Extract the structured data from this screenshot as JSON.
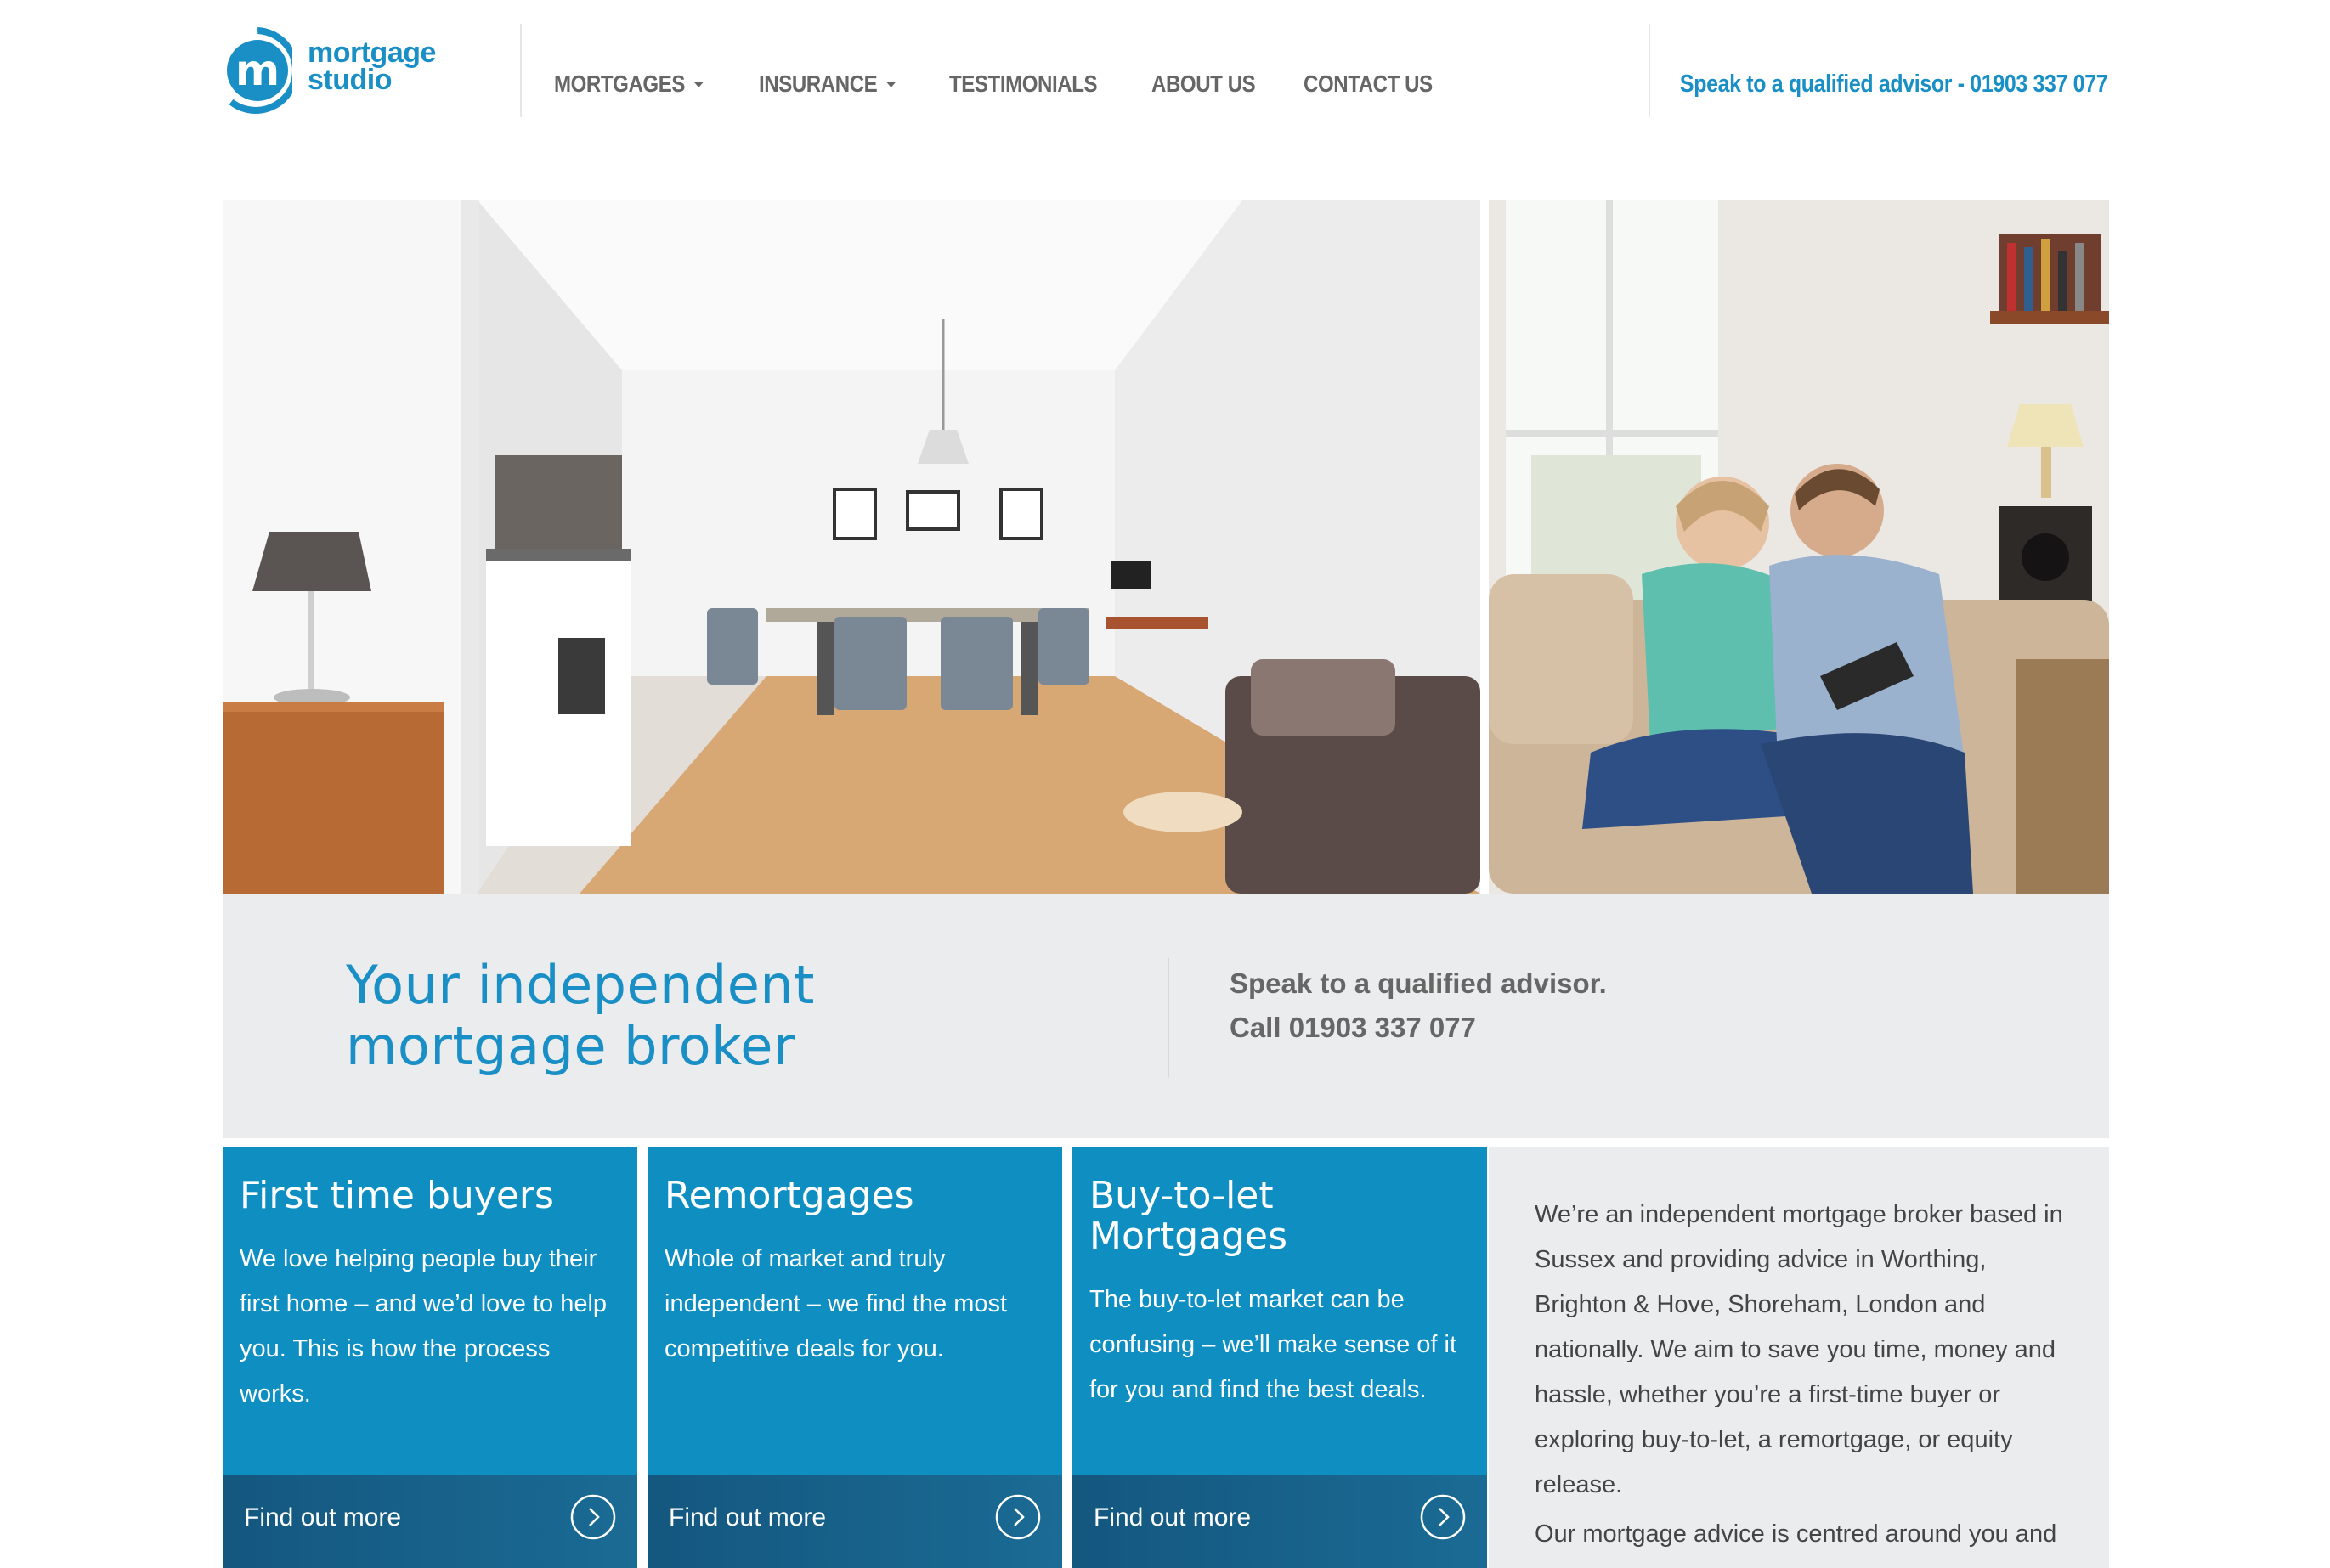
{
  "brand": {
    "logo_line1": "mortgage",
    "logo_line2": "studio",
    "logo_letter": "m",
    "primary_color": "#1a8fc6",
    "dark_color": "#14577f"
  },
  "nav": {
    "items": [
      {
        "label": "MORTGAGES",
        "has_dropdown": true
      },
      {
        "label": "INSURANCE",
        "has_dropdown": true
      },
      {
        "label": "TESTIMONIALS",
        "has_dropdown": false
      },
      {
        "label": "ABOUT US",
        "has_dropdown": false
      },
      {
        "label": "CONTACT US",
        "has_dropdown": false
      }
    ],
    "phone_cta": "Speak to a qualified advisor - 01903 337 077"
  },
  "hero": {
    "left_image": "kitchen-dining-interior-photo",
    "right_image": "couple-on-sofa-photo"
  },
  "band": {
    "title_line1": "Your independent",
    "title_line2": "mortgage broker",
    "call_line1": "Speak to a qualified advisor.",
    "call_line2": "Call 01903 337 077"
  },
  "cards": [
    {
      "title": "First time buyers",
      "body": "We love helping people buy their first home – and we’d love to help you. This is how the process works.",
      "cta": "Find out more"
    },
    {
      "title": "Remortgages",
      "body": "Whole of market and truly independent – we find the most competitive deals for you.",
      "cta": "Find out more"
    },
    {
      "title": "Buy-to-let Mortgages",
      "body": "The buy-to-let market can be confusing – we’ll make sense of it for you and find the best deals.",
      "cta": "Find out more"
    }
  ],
  "about": {
    "paragraph1": "We’re an independent mortgage broker based in Sussex and providing advice in Worthing, Brighton & Hove, Shoreham, London and nationally. We aim to save you time, money and hassle, whether you’re a first-time buyer or exploring buy-to-let, a remortgage, or equity release.",
    "paragraph2": "Our mortgage advice is centred around you and"
  }
}
